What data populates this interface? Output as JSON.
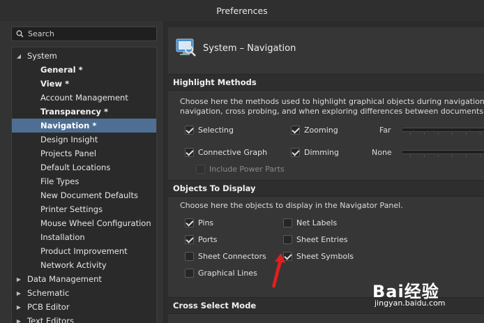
{
  "window": {
    "title": "Preferences"
  },
  "search": {
    "placeholder": "Search"
  },
  "tree": [
    {
      "label": "System",
      "level": 0,
      "expanded": true
    },
    {
      "label": "General *",
      "level": 1,
      "bold": true
    },
    {
      "label": "View *",
      "level": 1,
      "bold": true
    },
    {
      "label": "Account Management",
      "level": 1
    },
    {
      "label": "Transparency *",
      "level": 1,
      "bold": true
    },
    {
      "label": "Navigation *",
      "level": 1,
      "bold": true,
      "selected": true
    },
    {
      "label": "Design Insight",
      "level": 1
    },
    {
      "label": "Projects Panel",
      "level": 1
    },
    {
      "label": "Default Locations",
      "level": 1
    },
    {
      "label": "File Types",
      "level": 1
    },
    {
      "label": "New Document Defaults",
      "level": 1
    },
    {
      "label": "Printer Settings",
      "level": 1
    },
    {
      "label": "Mouse Wheel Configuration",
      "level": 1
    },
    {
      "label": "Installation",
      "level": 1
    },
    {
      "label": "Product Improvement",
      "level": 1
    },
    {
      "label": "Network Activity",
      "level": 1
    },
    {
      "label": "Data Management",
      "level": 0,
      "expanded": false
    },
    {
      "label": "Schematic",
      "level": 0,
      "expanded": false
    },
    {
      "label": "PCB Editor",
      "level": 0,
      "expanded": false
    },
    {
      "label": "Text Editors",
      "level": 0,
      "expanded": false
    }
  ],
  "page": {
    "title": "System – Navigation",
    "highlight": {
      "heading": "Highlight Methods",
      "desc_line1": "Choose here the methods used to highlight graphical objects during navigation. The",
      "desc_line2": "navigation, cross probing, and when exploring differences between documents or co",
      "selecting": {
        "label": "Selecting",
        "checked": true
      },
      "zooming": {
        "label": "Zooming",
        "checked": true
      },
      "connective": {
        "label": "Connective Graph",
        "checked": true
      },
      "dimming": {
        "label": "Dimming",
        "checked": true
      },
      "power": {
        "label": "Include Power Parts",
        "checked": false,
        "disabled": true
      },
      "far_label": "Far",
      "none_label": "None"
    },
    "objects": {
      "heading": "Objects To Display",
      "desc": "Choose here the objects to display in the Navigator Panel.",
      "pins": {
        "label": "Pins",
        "checked": true
      },
      "net_labels": {
        "label": "Net Labels",
        "checked": false
      },
      "ports": {
        "label": "Ports",
        "checked": true
      },
      "sheet_entries": {
        "label": "Sheet Entries",
        "checked": false
      },
      "sheet_connectors": {
        "label": "Sheet Connectors",
        "checked": false
      },
      "sheet_symbols": {
        "label": "Sheet Symbols",
        "checked": true
      },
      "graphical_lines": {
        "label": "Graphical Lines",
        "checked": false
      }
    },
    "cross": {
      "heading": "Cross Select Mode"
    }
  },
  "watermark": {
    "logo": "Bai经验",
    "url": "jingyan.baidu.com"
  },
  "colors": {
    "selected": "#4e6f93",
    "annotation_arrow": "#e02020"
  }
}
